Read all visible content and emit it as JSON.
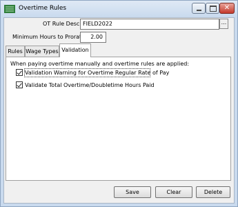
{
  "window": {
    "title": "Overtime Rules",
    "icon": "app-icon",
    "controls": {
      "minimize": "minimize-icon",
      "maximize": "maximize-icon",
      "close": "close-icon"
    }
  },
  "form": {
    "ot_rule_label": "OT Rule Description:",
    "ot_rule_value": "FIELD2022",
    "browse_label": "...",
    "min_hours_label": "Minimum Hours to Prorate:",
    "min_hours_value": "2.00"
  },
  "tabs": [
    {
      "label": "Rules",
      "active": false
    },
    {
      "label": "Wage Types",
      "active": false
    },
    {
      "label": "Validation",
      "active": true
    }
  ],
  "validation": {
    "heading": "When paying overtime manually and overtime rules are applied:",
    "options": [
      {
        "label": "Validation Warning for Overtime Regular Rate of Pay",
        "checked": true
      },
      {
        "label": "Validate Total Overtime/Doubletime Hours Paid",
        "checked": true
      }
    ]
  },
  "buttons": {
    "save": "Save",
    "clear": "Clear",
    "delete": "Delete"
  }
}
